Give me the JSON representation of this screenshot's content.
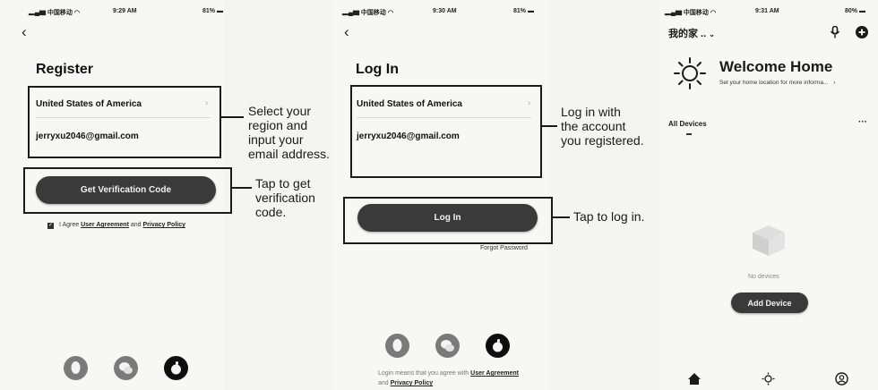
{
  "register_screen": {
    "status": {
      "carrier": "中国移动",
      "time": "9:29 AM",
      "battery": "81%"
    },
    "title": "Register",
    "region": "United States of America",
    "email": "jerryxu2046@gmail.com",
    "button": "Get Verification Code",
    "agree_prefix": "I Agree",
    "user_agreement": "User Agreement",
    "and": "and",
    "privacy_policy": "Privacy Policy",
    "callout_fields": "Select your\nregion and\ninput your\nemail address.",
    "callout_button": "Tap to get\nverification\ncode."
  },
  "login_screen": {
    "status": {
      "carrier": "中国移动",
      "time": "9:30 AM",
      "battery": "81%"
    },
    "title": "Log In",
    "region": "United States of America",
    "email": "jerryxu2046@gmail.com",
    "button": "Log In",
    "forgot": "Forgot Password",
    "callout_fields": "Log in with\nthe account\nyou registered.",
    "callout_button": "Tap to log in.",
    "consent_prefix": "Login means that you agree with",
    "user_agreement": "User Agreement",
    "and": "and",
    "privacy_policy": "Privacy Policy"
  },
  "home_screen": {
    "status": {
      "carrier": "中国移动",
      "time": "9:31 AM",
      "battery": "80%"
    },
    "home_name": "我的家 ..",
    "welcome": "Welcome Home",
    "location_prompt": "Set your home location for more informa...",
    "all_devices": "All Devices",
    "more": "···",
    "no_devices": "No devices",
    "add_device": "Add Device"
  },
  "icons": [
    "back-arrow-icon",
    "signal-icon",
    "wifi-icon",
    "battery-icon",
    "chevron-right-icon",
    "checkbox-icon",
    "qq-icon",
    "wechat-icon",
    "apple-icon",
    "sun-icon",
    "microphone-icon",
    "add-icon",
    "home-icon",
    "scene-icon",
    "profile-icon",
    "chevron-down-icon",
    "empty-box-icon"
  ]
}
